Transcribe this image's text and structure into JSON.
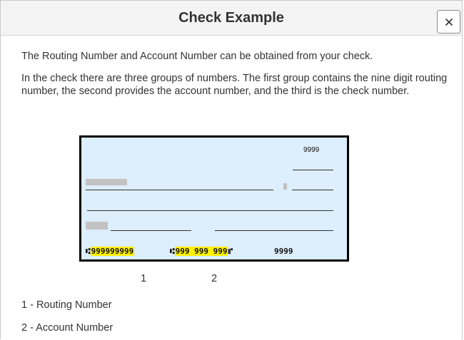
{
  "dialog": {
    "title": "Check Example",
    "close_label": "Close"
  },
  "content": {
    "intro": "The Routing Number and Account Number can be obtained from your check.",
    "description": "In the check there are three groups of numbers. The first group contains the nine digit routing number, the second provides the account number, and the third is the check number."
  },
  "check_image": {
    "check_number_top": "9999",
    "micr": {
      "routing_symbol": "⑆",
      "routing": "999999999",
      "account_symbol": "⑆",
      "account": "999 999 999",
      "on_us_symbol": "⑈",
      "check_number": "9999"
    },
    "highlight_color": "#fff200",
    "check_background": "#ddeefc"
  },
  "labels": {
    "marker_1": "1",
    "marker_2": "2",
    "legend_1": "1 - Routing Number",
    "legend_2": "2 - Account Number"
  }
}
